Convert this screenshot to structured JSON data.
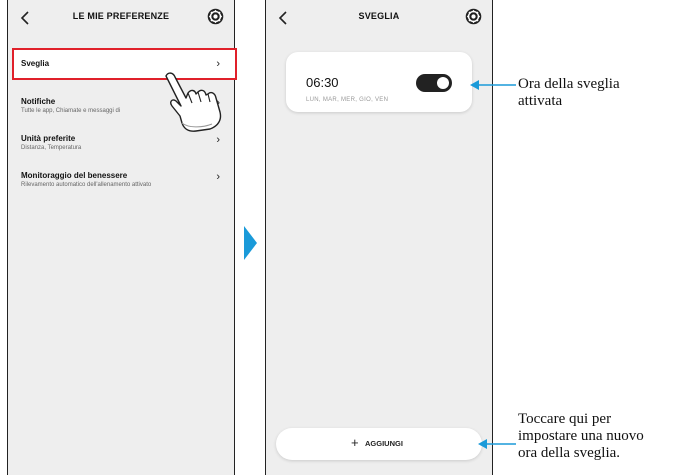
{
  "colors": {
    "accent": "#1a9ad9",
    "highlight": "#e0202a",
    "toggle_on": "#222222"
  },
  "screen1": {
    "title": "LE MIE PREFERENZE",
    "icons": {
      "back": "chevron-left-icon",
      "settings": "gear-icon",
      "pointer": "hand-pointer-icon"
    },
    "items": [
      {
        "label": "Sveglia",
        "sub": "",
        "chevron": "›"
      },
      {
        "label": "Notifiche",
        "sub": "Tutte le app, Chiamate e messaggi di",
        "chevron": "›"
      },
      {
        "label": "Unità preferite",
        "sub": "Distanza, Temperatura",
        "chevron": "›"
      },
      {
        "label": "Monitoraggio del benessere",
        "sub": "Rilevamento automatico dell'allenamento attivato",
        "chevron": "›"
      }
    ]
  },
  "screen2": {
    "title": "SVEGLIA",
    "icons": {
      "back": "chevron-left-icon",
      "settings": "gear-icon"
    },
    "alarm": {
      "time": "06:30",
      "days": "LUN, MAR, MER, GIO, VEN",
      "enabled": true
    },
    "add_button": {
      "plus": "+",
      "label": "AGGIUNGI"
    }
  },
  "annotations": {
    "toggle_line1": "Ora della sveglia",
    "toggle_line2": "attivata",
    "add_line1": "Toccare qui per",
    "add_line2": "impostare una nuovo",
    "add_line3": "ora della sveglia."
  }
}
